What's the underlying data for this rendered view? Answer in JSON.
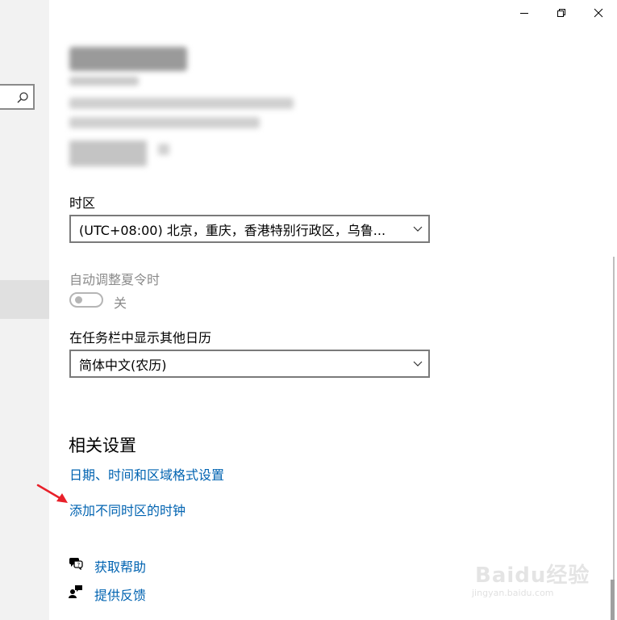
{
  "window": {
    "minimize_icon": "minimize-icon",
    "restore_icon": "restore-icon",
    "close_icon": "close-icon"
  },
  "sidebar": {
    "search_icon": "search-icon"
  },
  "timezone": {
    "label": "时区",
    "value": "(UTC+08:00) 北京，重庆，香港特别行政区，乌鲁..."
  },
  "dst": {
    "label": "自动调整夏令时",
    "toggle_state": "关",
    "enabled": false
  },
  "calendar": {
    "label": "在任务栏中显示其他日历",
    "value": "简体中文(农历)"
  },
  "related": {
    "heading": "相关设置",
    "links": [
      "日期、时间和区域格式设置",
      "添加不同时区的时钟"
    ]
  },
  "help": {
    "get_help": "获取帮助",
    "feedback": "提供反馈"
  },
  "annotation": {
    "arrow_color": "#e8202a"
  },
  "watermark": {
    "logo_text": "Baidu经验",
    "url": "jingyan.baidu.com"
  }
}
